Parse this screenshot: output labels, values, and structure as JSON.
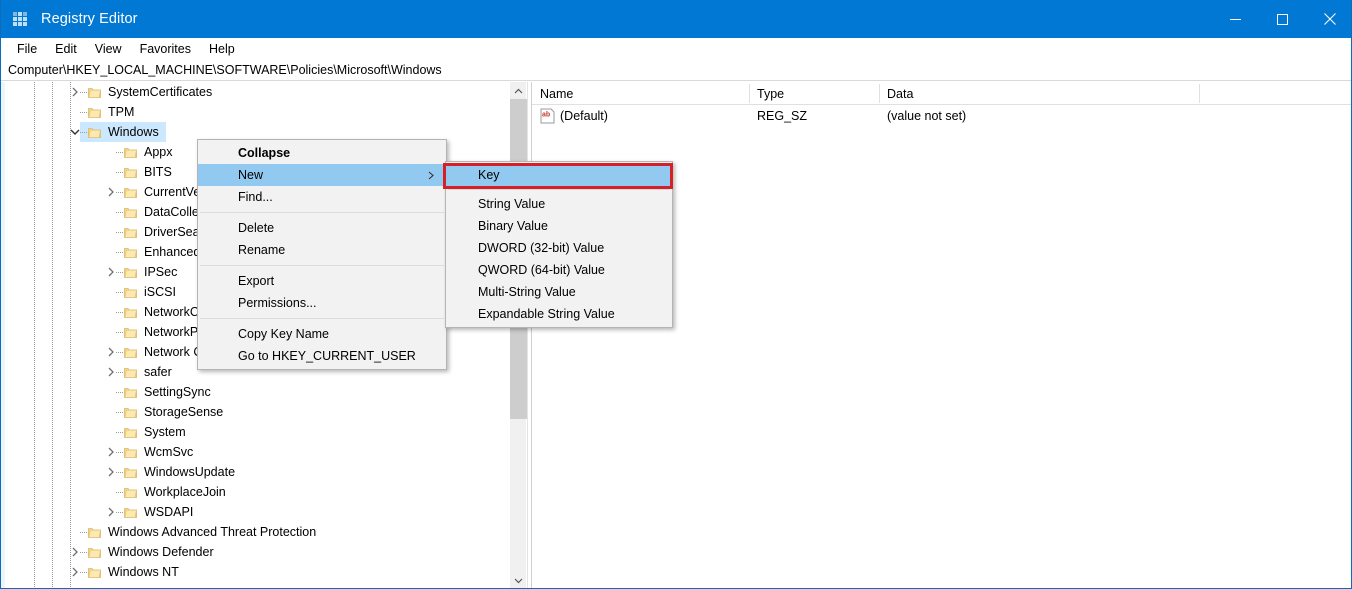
{
  "window": {
    "title": "Registry Editor",
    "icon": "registry-grid-icon",
    "accent_color": "#0078d4",
    "controls": [
      {
        "name": "minimize",
        "glyph": "minimize-icon"
      },
      {
        "name": "maximize",
        "glyph": "maximize-icon"
      },
      {
        "name": "close",
        "glyph": "close-icon"
      }
    ]
  },
  "menubar": {
    "items": [
      {
        "label": "File"
      },
      {
        "label": "Edit"
      },
      {
        "label": "View"
      },
      {
        "label": "Favorites"
      },
      {
        "label": "Help"
      }
    ]
  },
  "address": {
    "value": "Computer\\HKEY_LOCAL_MACHINE\\SOFTWARE\\Policies\\Microsoft\\Windows"
  },
  "tree": {
    "selected": "Windows",
    "items": [
      {
        "label": "SystemCertificates",
        "depth": 3,
        "expandable": true,
        "expanded": false,
        "selected": false
      },
      {
        "label": "TPM",
        "depth": 3,
        "expandable": false,
        "expanded": false,
        "selected": false
      },
      {
        "label": "Windows",
        "depth": 3,
        "expandable": true,
        "expanded": true,
        "selected": true
      },
      {
        "label": "Appx",
        "depth": 4,
        "expandable": false,
        "expanded": false,
        "selected": false
      },
      {
        "label": "BITS",
        "depth": 4,
        "expandable": false,
        "expanded": false,
        "selected": false
      },
      {
        "label": "CurrentVersion",
        "depth": 4,
        "expandable": true,
        "expanded": false,
        "selected": false
      },
      {
        "label": "DataCollection",
        "depth": 4,
        "expandable": false,
        "expanded": false,
        "selected": false
      },
      {
        "label": "DriverSearching",
        "depth": 4,
        "expandable": false,
        "expanded": false,
        "selected": false
      },
      {
        "label": "EnhancedStorageDevices",
        "depth": 4,
        "expandable": false,
        "expanded": false,
        "selected": false
      },
      {
        "label": "IPSec",
        "depth": 4,
        "expandable": true,
        "expanded": false,
        "selected": false
      },
      {
        "label": "iSCSI",
        "depth": 4,
        "expandable": false,
        "expanded": false,
        "selected": false
      },
      {
        "label": "NetworkConnections",
        "depth": 4,
        "expandable": false,
        "expanded": false,
        "selected": false
      },
      {
        "label": "NetworkProvider",
        "depth": 4,
        "expandable": false,
        "expanded": false,
        "selected": false
      },
      {
        "label": "Network Connectivity Status Indicator",
        "depth": 4,
        "expandable": true,
        "expanded": false,
        "selected": false
      },
      {
        "label": "safer",
        "depth": 4,
        "expandable": true,
        "expanded": false,
        "selected": false
      },
      {
        "label": "SettingSync",
        "depth": 4,
        "expandable": false,
        "expanded": false,
        "selected": false
      },
      {
        "label": "StorageSense",
        "depth": 4,
        "expandable": false,
        "expanded": false,
        "selected": false
      },
      {
        "label": "System",
        "depth": 4,
        "expandable": false,
        "expanded": false,
        "selected": false
      },
      {
        "label": "WcmSvc",
        "depth": 4,
        "expandable": true,
        "expanded": false,
        "selected": false
      },
      {
        "label": "WindowsUpdate",
        "depth": 4,
        "expandable": true,
        "expanded": false,
        "selected": false
      },
      {
        "label": "WorkplaceJoin",
        "depth": 4,
        "expandable": false,
        "expanded": false,
        "selected": false
      },
      {
        "label": "WSDAPI",
        "depth": 4,
        "expandable": true,
        "expanded": false,
        "selected": false
      },
      {
        "label": "Windows Advanced Threat Protection",
        "depth": 3,
        "expandable": false,
        "expanded": false,
        "selected": false
      },
      {
        "label": "Windows Defender",
        "depth": 3,
        "expandable": true,
        "expanded": false,
        "selected": false
      },
      {
        "label": "Windows NT",
        "depth": 3,
        "expandable": true,
        "expanded": false,
        "selected": false
      }
    ]
  },
  "list": {
    "columns": [
      {
        "label": "Name"
      },
      {
        "label": "Type"
      },
      {
        "label": "Data"
      }
    ],
    "rows": [
      {
        "icon": "string-value-ab-icon",
        "name": "(Default)",
        "type": "REG_SZ",
        "data": "(value not set)"
      }
    ]
  },
  "context_menu": {
    "items": [
      {
        "label": "Collapse",
        "bold": true,
        "highlighted": false,
        "submenu": false
      },
      {
        "label": "New",
        "bold": false,
        "highlighted": true,
        "submenu": true
      },
      {
        "label": "Find...",
        "bold": false,
        "highlighted": false,
        "submenu": false
      },
      {
        "separator": true
      },
      {
        "label": "Delete",
        "bold": false,
        "highlighted": false,
        "submenu": false
      },
      {
        "label": "Rename",
        "bold": false,
        "highlighted": false,
        "submenu": false
      },
      {
        "separator": true
      },
      {
        "label": "Export",
        "bold": false,
        "highlighted": false,
        "submenu": false
      },
      {
        "label": "Permissions...",
        "bold": false,
        "highlighted": false,
        "submenu": false
      },
      {
        "separator": true
      },
      {
        "label": "Copy Key Name",
        "bold": false,
        "highlighted": false,
        "submenu": false
      },
      {
        "label": "Go to HKEY_CURRENT_USER",
        "bold": false,
        "highlighted": false,
        "submenu": false
      }
    ]
  },
  "submenu": {
    "items": [
      {
        "label": "Key",
        "highlighted": true
      },
      {
        "separator": true
      },
      {
        "label": "String Value",
        "highlighted": false
      },
      {
        "label": "Binary Value",
        "highlighted": false
      },
      {
        "label": "DWORD (32-bit) Value",
        "highlighted": false
      },
      {
        "label": "QWORD (64-bit) Value",
        "highlighted": false
      },
      {
        "label": "Multi-String Value",
        "highlighted": false
      },
      {
        "label": "Expandable String Value",
        "highlighted": false
      }
    ]
  },
  "annotation": {
    "highlight_color": "#d62027",
    "target": "Key"
  },
  "scrollbar": {
    "up_arrow": "chevron-up-icon",
    "down_arrow": "chevron-down-icon"
  }
}
